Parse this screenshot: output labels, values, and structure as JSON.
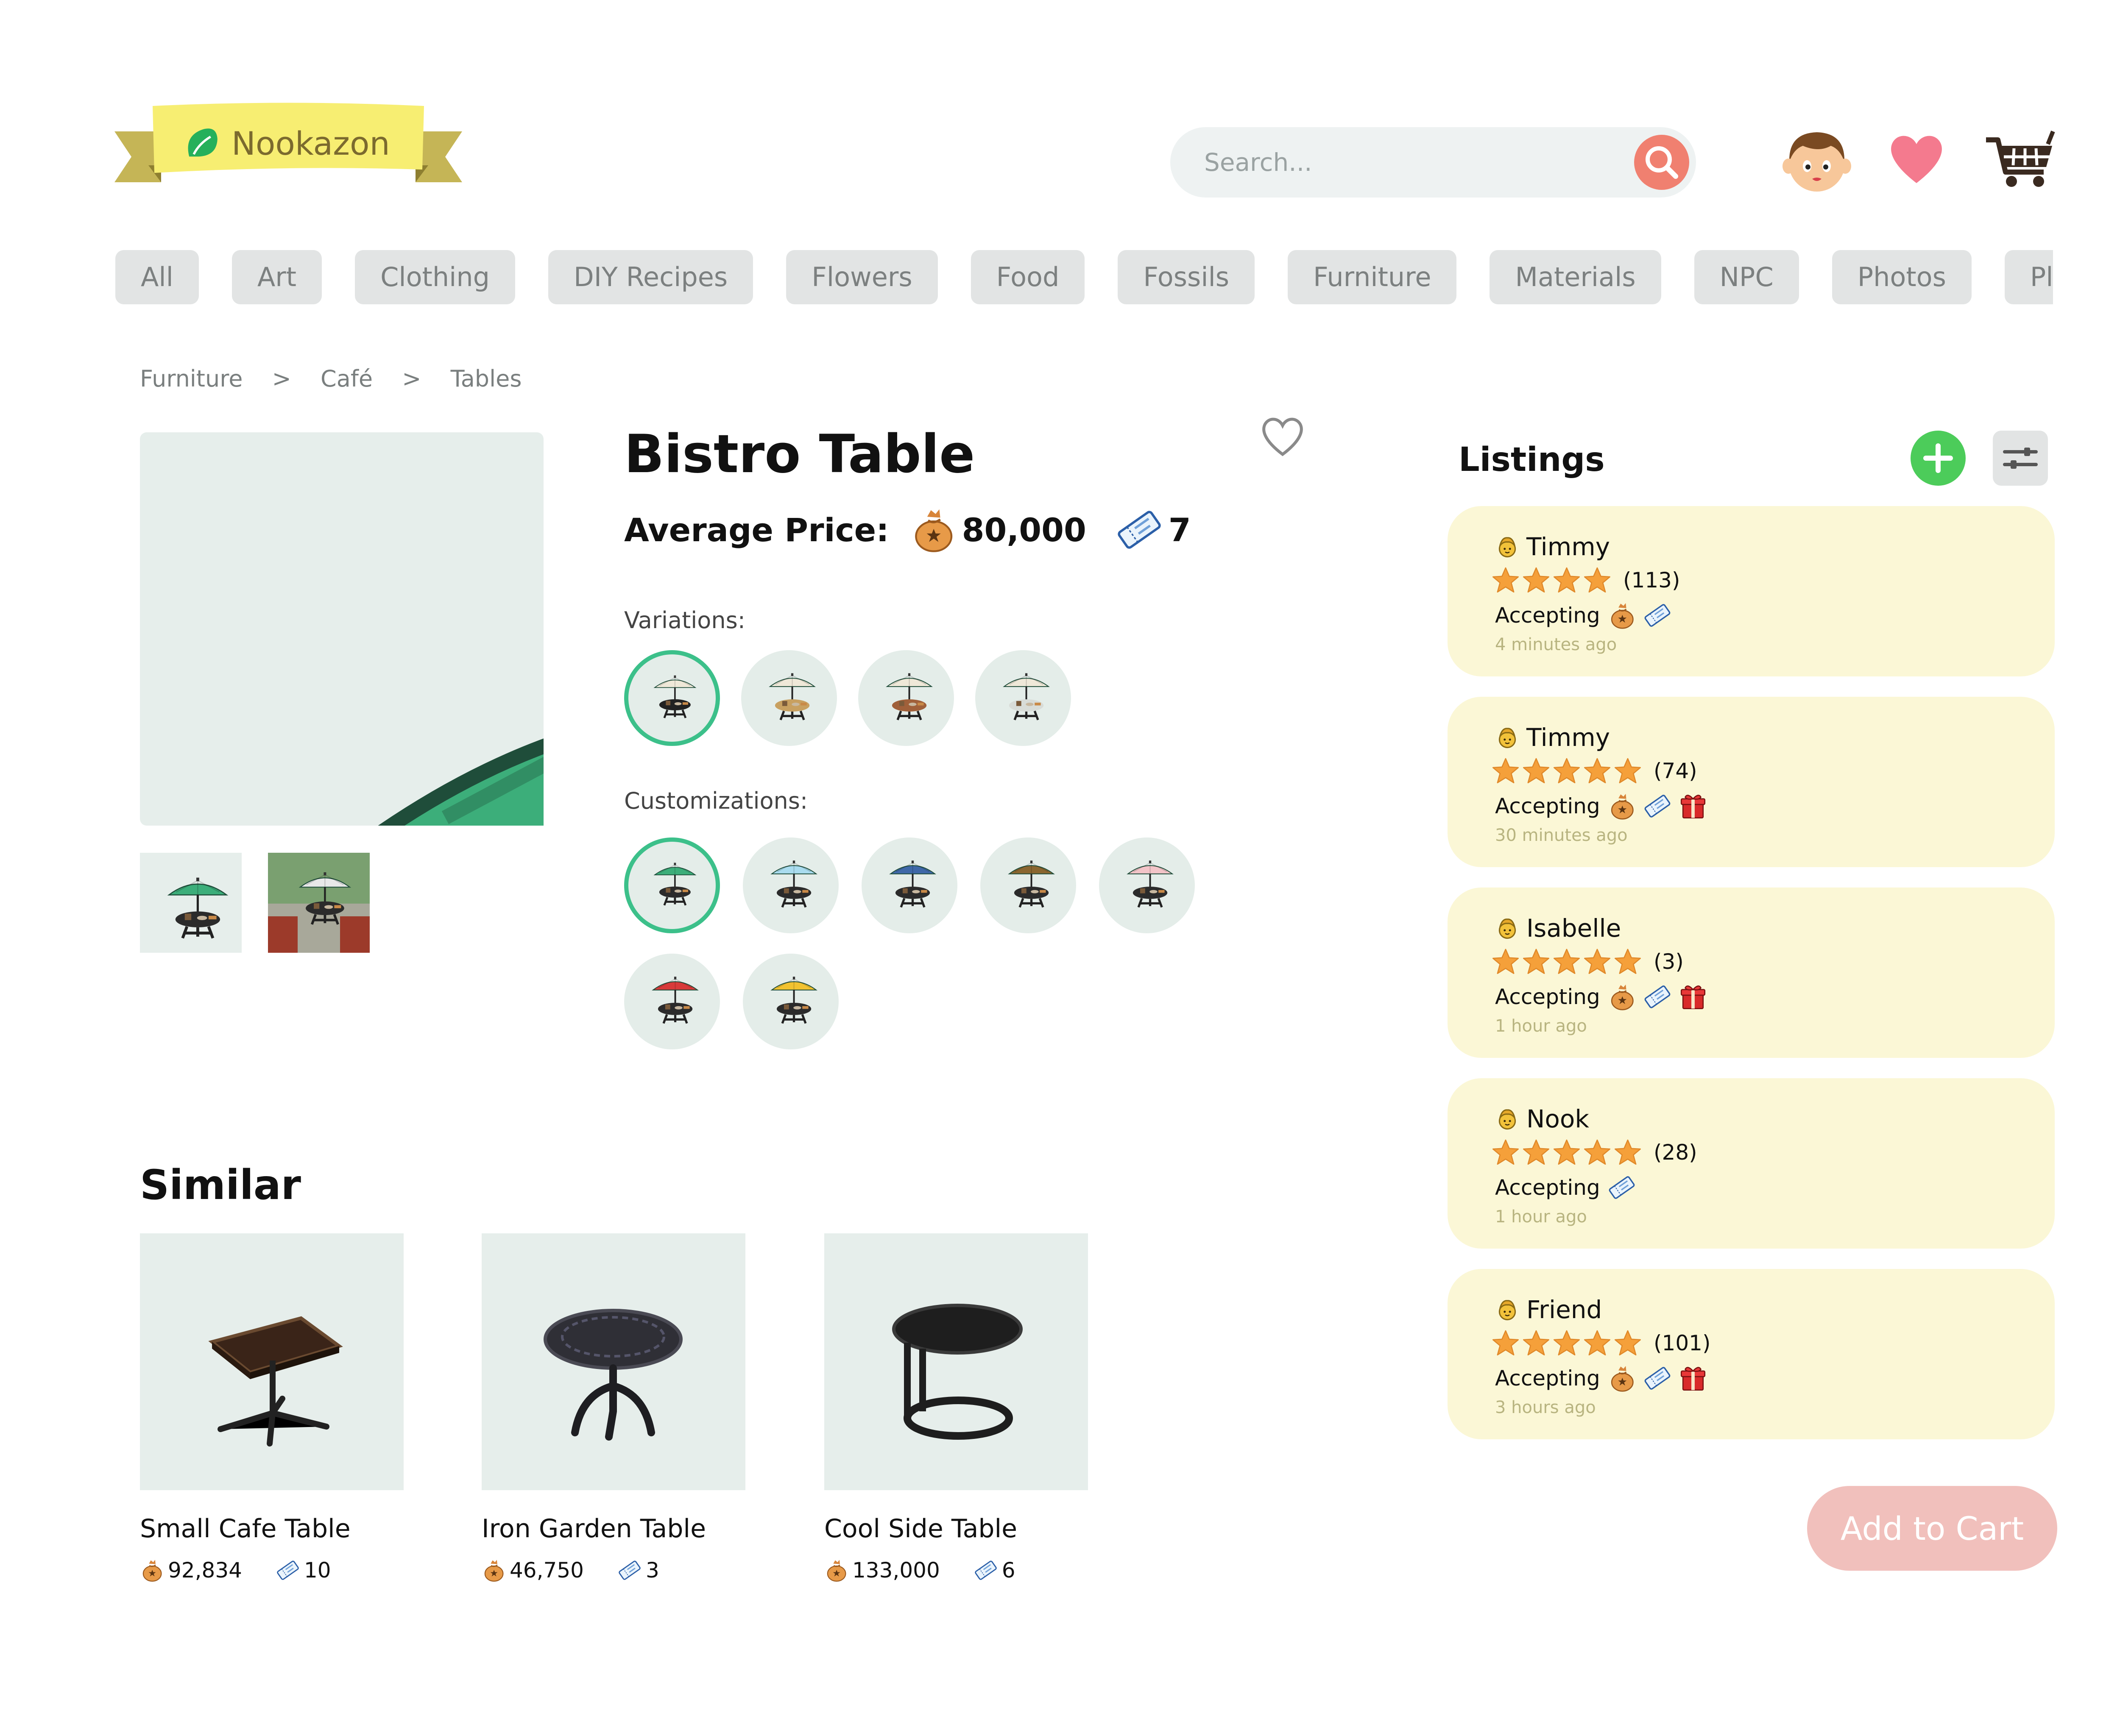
{
  "brand": {
    "name": "Nookazon"
  },
  "search": {
    "placeholder": "Search..."
  },
  "categories": [
    "All",
    "Art",
    "Clothing",
    "DIY Recipes",
    "Flowers",
    "Food",
    "Fossils",
    "Furniture",
    "Materials",
    "NPC",
    "Photos",
    "Plant"
  ],
  "breadcrumb": {
    "items": [
      "Furniture",
      "Café",
      "Tables"
    ],
    "separator": ">"
  },
  "product": {
    "title": "Bistro Table",
    "avg_label": "Average Price:",
    "bells": "80,000",
    "tickets": "7",
    "variations_label": "Variations:",
    "customizations_label": "Customizations:",
    "variation_colors": [
      "#222222",
      "#c8a060",
      "#a0603a",
      "#d8dcd8"
    ],
    "customization_colors": [
      "#3cae7a",
      "#a9dcef",
      "#3f68a8",
      "#8a6630",
      "#f3c4c8",
      "#d83a3a",
      "#f2c230"
    ]
  },
  "similar": {
    "title": "Similar",
    "items": [
      {
        "name": "Small Cafe Table",
        "bells": "92,834",
        "tickets": "10"
      },
      {
        "name": "Iron Garden Table",
        "bells": "46,750",
        "tickets": "3"
      },
      {
        "name": "Cool Side Table",
        "bells": "133,000",
        "tickets": "6"
      }
    ]
  },
  "listings": {
    "title": "Listings",
    "accepting_label": "Accepting",
    "items": [
      {
        "user": "Timmy",
        "rating": 4,
        "reviews": "(113)",
        "accepts": [
          "bells",
          "tickets"
        ],
        "time": "4 minutes ago"
      },
      {
        "user": "Timmy",
        "rating": 5,
        "reviews": "(74)",
        "accepts": [
          "bells",
          "tickets",
          "gifts"
        ],
        "time": "30 minutes ago"
      },
      {
        "user": "Isabelle",
        "rating": 5,
        "reviews": "(3)",
        "accepts": [
          "bells",
          "tickets",
          "gifts"
        ],
        "time": "1 hour ago"
      },
      {
        "user": "Nook",
        "rating": 5,
        "reviews": "(28)",
        "accepts": [
          "tickets"
        ],
        "time": "1 hour ago"
      },
      {
        "user": "Friend",
        "rating": 5,
        "reviews": "(101)",
        "accepts": [
          "bells",
          "tickets",
          "gifts"
        ],
        "time": "3 hours ago"
      }
    ]
  },
  "cart": {
    "add_label": "Add to Cart"
  },
  "colors": {
    "accent_green": "#3cc08a",
    "listing_bg": "#fbf7d6",
    "add_button": "#4ccc5a",
    "search_button": "#f08070",
    "heart": "#f47a8e"
  },
  "icons": {
    "search": "search-icon",
    "avatar": "villager-avatar-icon",
    "wishlist": "heart-icon",
    "cart": "shopping-cart-icon",
    "bells": "bell-bag-icon",
    "tickets": "nook-miles-ticket-icon",
    "gifts": "gift-icon"
  }
}
